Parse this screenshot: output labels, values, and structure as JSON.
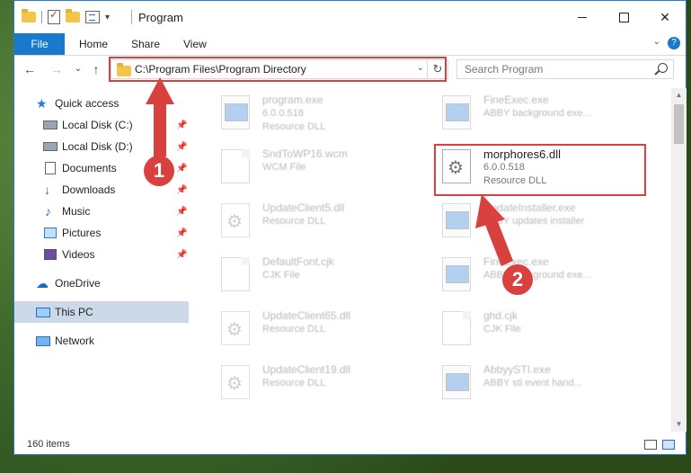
{
  "window": {
    "title": "Program",
    "controls": {
      "minimize": "minimize",
      "maximize": "maximize",
      "close": "✕"
    }
  },
  "ribbon": {
    "file": "File",
    "tabs": [
      "Home",
      "Share",
      "View"
    ],
    "help": "?"
  },
  "nav": {
    "back": "←",
    "forward": "→",
    "recent": "⌄",
    "up": "↑",
    "address": "C:\\Program Files\\Program Directory",
    "refresh": "↻",
    "search_placeholder": "Search Program"
  },
  "sidebar": {
    "items": [
      {
        "label": "Quick access",
        "icon": "star-icon"
      },
      {
        "label": "Local Disk (C:)",
        "icon": "drive-icon",
        "pinned": true
      },
      {
        "label": "Local Disk (D:)",
        "icon": "drive-icon",
        "pinned": true
      },
      {
        "label": "Documents",
        "icon": "document-icon",
        "pinned": true
      },
      {
        "label": "Downloads",
        "icon": "download-icon",
        "pinned": true
      },
      {
        "label": "Music",
        "icon": "music-icon",
        "pinned": true
      },
      {
        "label": "Pictures",
        "icon": "pictures-icon",
        "pinned": true
      },
      {
        "label": "Videos",
        "icon": "videos-icon",
        "pinned": true
      },
      {
        "label": "OneDrive",
        "icon": "cloud-icon"
      },
      {
        "label": "This PC",
        "icon": "computer-icon",
        "selected": true
      },
      {
        "label": "Network",
        "icon": "network-icon"
      }
    ]
  },
  "files": [
    {
      "name": "program.exe",
      "line1": "6.0.0.518",
      "line2": "Resource DLL",
      "icon": "app-icon",
      "faded": true
    },
    {
      "name": "FineExec.exe",
      "line1": "ABBY background exe...",
      "line2": "",
      "icon": "app-icon",
      "faded": true
    },
    {
      "name": "SndToWP16.wcm",
      "line1": "WCM File",
      "line2": "",
      "icon": "file-icon",
      "faded": true
    },
    {
      "name": "morphores6.dll",
      "line1": "6.0.0.518",
      "line2": "Resource DLL",
      "icon": "dll-icon",
      "faded": false
    },
    {
      "name": "UpdateClient5.dll",
      "line1": "Resource DLL",
      "line2": "",
      "icon": "dll-icon",
      "faded": true
    },
    {
      "name": "UpdateInstaller.exe",
      "line1": "ABBY updates installer",
      "line2": "",
      "icon": "app-icon",
      "faded": true
    },
    {
      "name": "DefaultFont.cjk",
      "line1": "CJK File",
      "line2": "",
      "icon": "file-icon",
      "faded": true
    },
    {
      "name": "FineExec.exe",
      "line1": "ABBY background exe...",
      "line2": "",
      "icon": "app-icon",
      "faded": true
    },
    {
      "name": "UpdateClient65.dll",
      "line1": "Resource DLL",
      "line2": "",
      "icon": "dll-icon",
      "faded": true
    },
    {
      "name": "ghd.cjk",
      "line1": "CJK File",
      "line2": "",
      "icon": "file-icon",
      "faded": true
    },
    {
      "name": "UpdateClient19.dll",
      "line1": "Resource DLL",
      "line2": "",
      "icon": "dll-icon",
      "faded": true
    },
    {
      "name": "AbbyySTI.exe",
      "line1": "ABBY sti event hand...",
      "line2": "",
      "icon": "app-icon",
      "faded": true
    }
  ],
  "status": {
    "item_count": "160 items"
  },
  "annotations": [
    {
      "number": "1",
      "target": "address bar"
    },
    {
      "number": "2",
      "target": "morphores6.dll"
    }
  ],
  "colors": {
    "accent": "#1979ca",
    "annotation": "#d9413f",
    "selection": "#ccd9e9"
  }
}
